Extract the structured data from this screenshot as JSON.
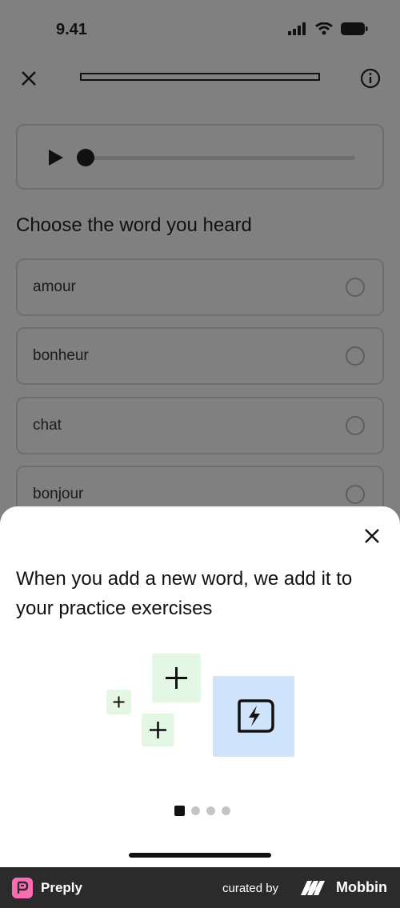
{
  "status_bar": {
    "time": "9.41"
  },
  "lesson": {
    "progress": 0.0,
    "question": "Choose the word you heard",
    "audio_progress": 0.0,
    "options": [
      {
        "label": "amour"
      },
      {
        "label": "bonheur"
      },
      {
        "label": "chat"
      },
      {
        "label": "bonjour"
      }
    ]
  },
  "sheet": {
    "title": "When you add a new word, we add it to your practice exercises",
    "page_count": 4,
    "current_page": 1
  },
  "footer": {
    "brand": "Preply",
    "curated_by": "curated by",
    "curator": "Mobbin"
  },
  "colors": {
    "overlay_bg": "#808080",
    "sheet_bg": "#ffffff",
    "tile_green": "#e3f7e4",
    "tile_blue": "#cfe3fb",
    "preply_pink": "#ff6bb3",
    "footer_bg": "#2b2b2b"
  },
  "icons": [
    "close-icon",
    "info-icon",
    "play-icon",
    "plus-icon",
    "flash-card-icon",
    "signal-icon",
    "wifi-icon",
    "battery-icon"
  ]
}
